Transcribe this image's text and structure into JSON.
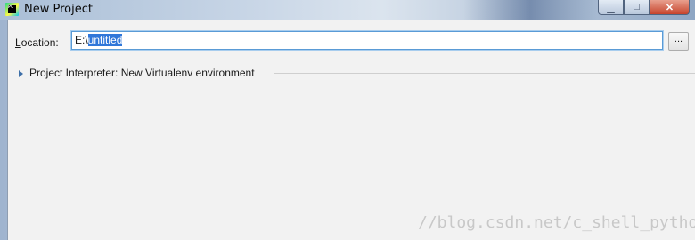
{
  "window": {
    "title": "New Project",
    "controls": {
      "minimize": "▁",
      "maximize": "□",
      "close": "✕"
    },
    "app_icon_text": "PC"
  },
  "location": {
    "label_prefix": "",
    "label_access_key": "L",
    "label_rest": "ocation:",
    "value_prefix": "E:\\",
    "value_selected": "untitled",
    "browse_label": "..."
  },
  "interpreter": {
    "label": "Project Interpreter: New Virtualenv environment",
    "expanded": false
  },
  "watermark": "//blog.csdn.net/c_shell_python",
  "colors": {
    "selection": "#3077d9",
    "focus_border": "#5a9bd6",
    "client_bg": "#f2f2f2"
  }
}
